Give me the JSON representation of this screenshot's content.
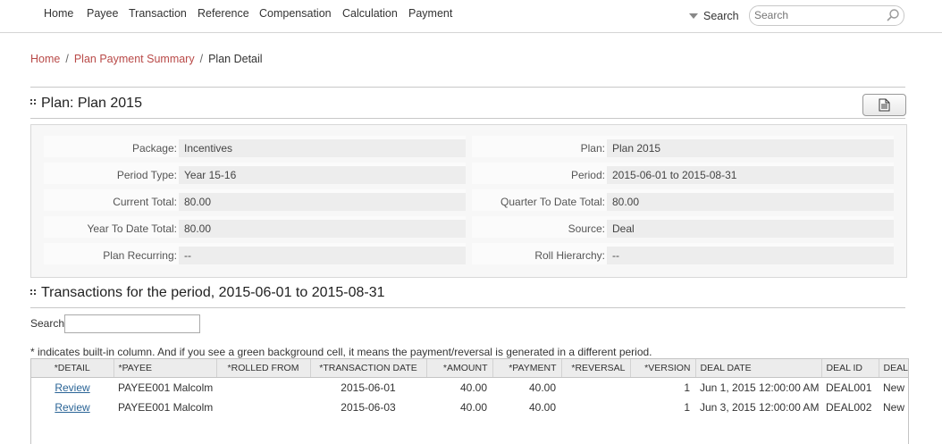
{
  "nav": {
    "items": [
      "Home",
      "Payee",
      "Transaction",
      "Reference",
      "Compensation",
      "Calculation",
      "Payment"
    ],
    "search_toggle": "Search",
    "search_placeholder": "Search"
  },
  "breadcrumb": {
    "home": "Home",
    "summary": "Plan Payment Summary",
    "current": "Plan Detail"
  },
  "plan": {
    "title": "Plan: Plan 2015",
    "fields_left": [
      {
        "label": "Package:",
        "value": "Incentives"
      },
      {
        "label": "Period Type:",
        "value": "Year 15-16"
      },
      {
        "label": "Current Total:",
        "value": "80.00"
      },
      {
        "label": "Year To Date Total:",
        "value": "80.00"
      },
      {
        "label": "Plan Recurring:",
        "value": "--"
      }
    ],
    "fields_right": [
      {
        "label": "Plan:",
        "value": "Plan 2015"
      },
      {
        "label": "Period:",
        "value": "2015-06-01 to 2015-08-31"
      },
      {
        "label": "Quarter To Date Total:",
        "value": "80.00"
      },
      {
        "label": "Source:",
        "value": "Deal"
      },
      {
        "label": "Roll Hierarchy:",
        "value": "--"
      }
    ]
  },
  "transactions": {
    "title": "Transactions for the period, 2015-06-01 to 2015-08-31",
    "search_label": "Search:",
    "note": "* indicates built-in column. And if you see a green background cell, it means the payment/reversal is generated in a different period.",
    "columns": [
      "*DETAIL",
      "*PAYEE",
      "*ROLLED FROM",
      "*TRANSACTION DATE",
      "*AMOUNT",
      "*PAYMENT",
      "*REVERSAL",
      "*VERSION",
      "DEAL DATE",
      "DEAL ID",
      "DEAL TYPE"
    ],
    "rows": [
      {
        "detail": "Review",
        "payee": "PAYEE001 Malcolm",
        "rolled_from": "",
        "transaction_date": "2015-06-01",
        "amount": "40.00",
        "payment": "40.00",
        "reversal": "",
        "version": "1",
        "deal_date": "Jun 1, 2015 12:00:00 AM",
        "deal_id": "DEAL001",
        "deal_type": "New"
      },
      {
        "detail": "Review",
        "payee": "PAYEE001 Malcolm",
        "rolled_from": "",
        "transaction_date": "2015-06-03",
        "amount": "40.00",
        "payment": "40.00",
        "reversal": "",
        "version": "1",
        "deal_date": "Jun 3, 2015 12:00:00 AM",
        "deal_id": "DEAL002",
        "deal_type": "New"
      }
    ]
  }
}
